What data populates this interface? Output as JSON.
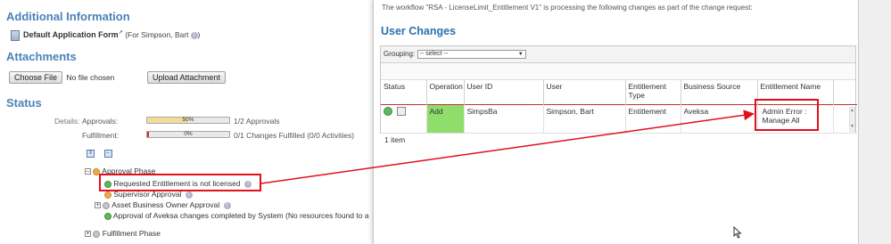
{
  "left": {
    "additional_info_title": "Additional Information",
    "form_link": "Default Application Form",
    "form_link_suffix": "↗",
    "form_for": "(For Simpson, Bart",
    "form_for_close": ")",
    "attachments_title": "Attachments",
    "choose_file_label": "Choose File",
    "no_file_text": "No file chosen",
    "upload_label": "Upload Attachment",
    "status_title": "Status",
    "details_label": "Details:",
    "approvals_label": "Approvals:",
    "approvals_bar_text": "50%",
    "approvals_progress": 0.5,
    "approvals_count": "1/2 Approvals",
    "fulfillment_label": "Fulfillment:",
    "fulfillment_bar_text": "0%",
    "fulfillment_progress": 0.0,
    "fulfillment_count": "0/1 Changes Fulfilled (0/0 Activities)",
    "approval_phase_label": "Approval Phase",
    "requested_entitlement_label": "Requested Entitlement is not licensed",
    "supervisor_approval_label": "Supervisor Approval",
    "asset_owner_label": "Asset Business Owner Approval",
    "approval_completed_label": "Approval of Aveksa changes completed by System (No resources found to a",
    "fulfillment_phase_label": "Fulfillment Phase"
  },
  "popup": {
    "workflow_text": "The workflow \"RSA - LicenseLimit_Entitlement V1\" is processing the following changes as part of the change request:",
    "section_title": "User Changes",
    "grouping_label": "Grouping:",
    "grouping_value": "-- select --",
    "columns": [
      "Status",
      "Operation",
      "User ID",
      "User",
      "Entitlement Type",
      "Business Source",
      "Entitlement Name"
    ],
    "row": {
      "operation": "Add",
      "user_id": "SimpsBa",
      "user": "Simpson, Bart",
      "entitlement_type": "Entitlement",
      "business_source": "Aveksa",
      "entitlement_name_line1": "Admin Error :",
      "entitlement_name_line2": "Manage All"
    },
    "item_count": "1 item"
  },
  "colors": {
    "section_title": "#4a82b8",
    "add_cell": "#8fdd6a",
    "highlight": "#e0101c",
    "approval_bar": "#f2dc9a"
  }
}
